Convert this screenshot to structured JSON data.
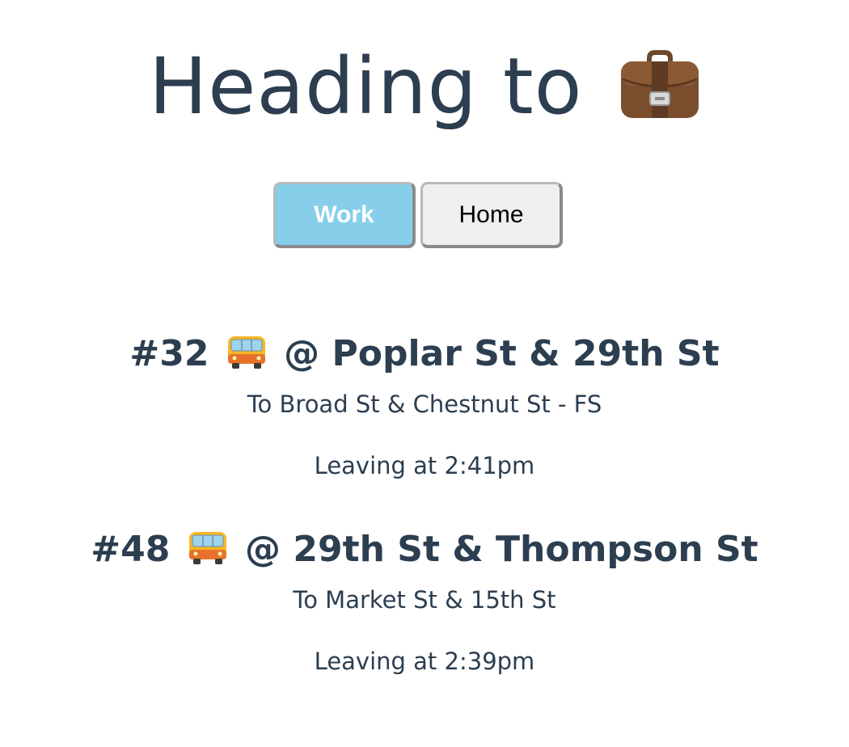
{
  "header": {
    "title": "Heading to",
    "icon": "briefcase-icon"
  },
  "toggle": {
    "work_label": "Work",
    "home_label": "Home",
    "selected": "Work",
    "active_color": "#87ceeb",
    "inactive_color": "#efefef"
  },
  "routes": [
    {
      "number": "#32",
      "icon": "bus-icon",
      "stop": "@ Poplar St & 29th St",
      "destination": "To Broad St & Chestnut St - FS",
      "leaving": "Leaving at 2:41pm"
    },
    {
      "number": "#48",
      "icon": "bus-icon",
      "stop": "@ 29th St & Thompson St",
      "destination": "To Market St & 15th St",
      "leaving": "Leaving at 2:39pm"
    }
  ],
  "colors": {
    "text": "#2c3e50",
    "accent": "#87ceeb"
  }
}
